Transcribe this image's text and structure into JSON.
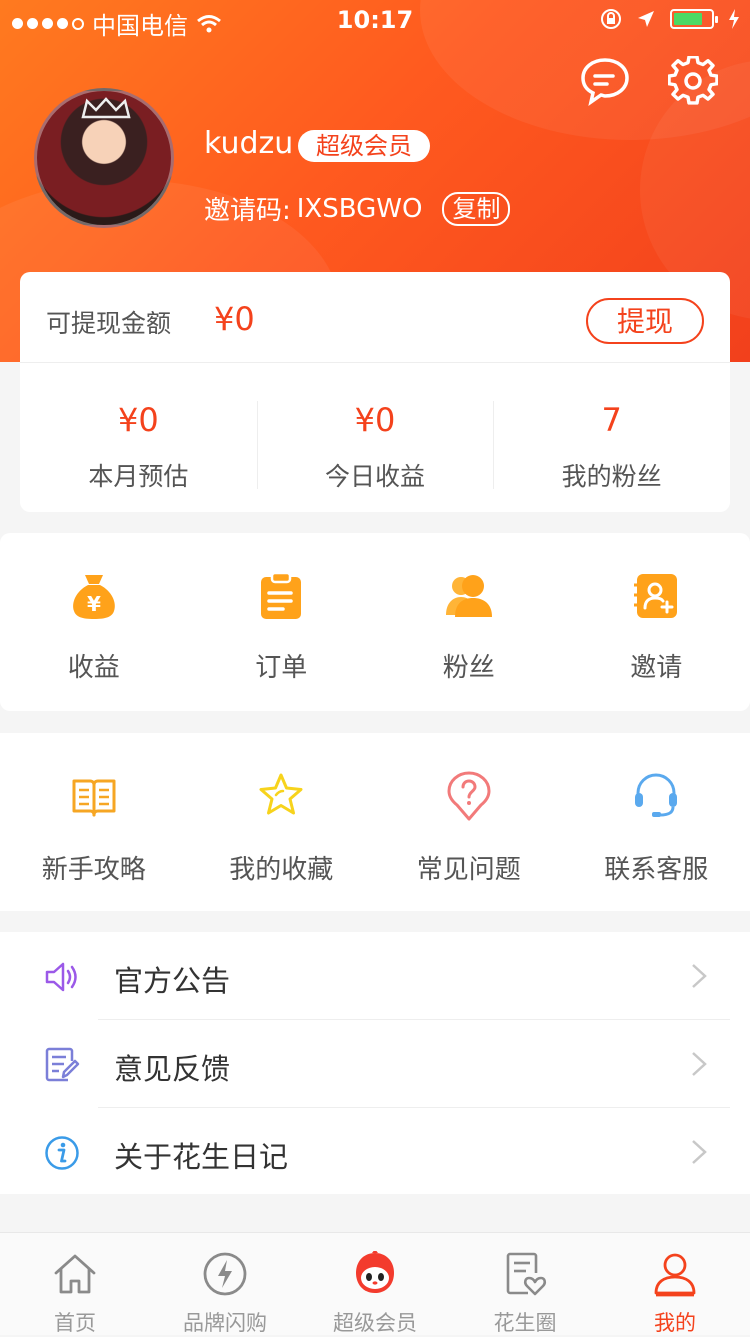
{
  "status": {
    "carrier": "中国电信",
    "time": "10:17",
    "battery_color": "#4cd964"
  },
  "header": {
    "username": "kudzu",
    "member_badge": "超级会员",
    "invite_label": "邀请码:",
    "invite_code": "IXSBGWO",
    "copy_label": "复制",
    "message_icon": "message-icon",
    "settings_icon": "gear-icon",
    "accent": "#f4421c"
  },
  "balance": {
    "label": "可提现金额",
    "amount": "¥0",
    "withdraw_label": "提现",
    "stats": [
      {
        "value": "¥0",
        "label": "本月预估"
      },
      {
        "value": "¥0",
        "label": "今日收益"
      },
      {
        "value": "7",
        "label": "我的粉丝"
      }
    ]
  },
  "shortcuts": [
    {
      "label": "收益",
      "icon": "money-bag-icon"
    },
    {
      "label": "订单",
      "icon": "clipboard-icon"
    },
    {
      "label": "粉丝",
      "icon": "fans-icon"
    },
    {
      "label": "邀请",
      "icon": "invite-icon"
    }
  ],
  "services": [
    {
      "label": "新手攻略",
      "icon": "book-icon"
    },
    {
      "label": "我的收藏",
      "icon": "star-icon"
    },
    {
      "label": "常见问题",
      "icon": "question-icon"
    },
    {
      "label": "联系客服",
      "icon": "headset-icon"
    }
  ],
  "menu": [
    {
      "label": "官方公告",
      "icon": "speaker-icon"
    },
    {
      "label": "意见反馈",
      "icon": "feedback-icon"
    },
    {
      "label": "关于花生日记",
      "icon": "info-icon"
    }
  ],
  "tabs": [
    {
      "label": "首页",
      "icon": "home-icon"
    },
    {
      "label": "品牌闪购",
      "icon": "flash-icon"
    },
    {
      "label": "超级会员",
      "icon": "mascot-icon"
    },
    {
      "label": "花生圈",
      "icon": "heart-note-icon"
    },
    {
      "label": "我的",
      "icon": "person-icon",
      "active": true
    }
  ]
}
